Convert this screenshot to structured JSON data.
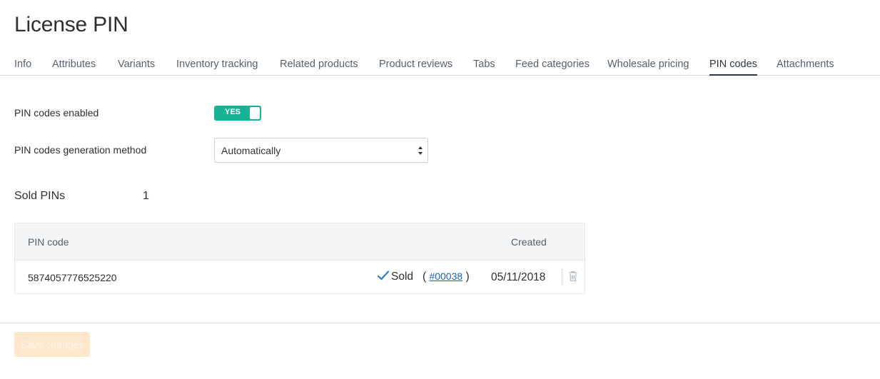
{
  "page": {
    "title": "License PIN"
  },
  "tabs": [
    {
      "label": "Info",
      "active": false
    },
    {
      "label": "Attributes",
      "active": false
    },
    {
      "label": "Variants",
      "active": false
    },
    {
      "label": "Inventory tracking",
      "active": false
    },
    {
      "label": "Related products",
      "active": false
    },
    {
      "label": "Product reviews",
      "active": false
    },
    {
      "label": "Tabs",
      "active": false
    },
    {
      "label": "Feed categories",
      "active": false
    },
    {
      "label": "Wholesale pricing",
      "active": false
    },
    {
      "label": "PIN codes",
      "active": true
    },
    {
      "label": "Attachments",
      "active": false
    }
  ],
  "form": {
    "pin_enabled_label": "PIN codes enabled",
    "pin_enabled_toggle": "YES",
    "generation_method_label": "PIN codes generation method",
    "generation_method_value": "Automatically"
  },
  "sold": {
    "label": "Sold PINs",
    "count": "1"
  },
  "table": {
    "headers": {
      "pin": "PIN code",
      "created": "Created"
    },
    "rows": [
      {
        "pin": "5874057776525220",
        "status": "Sold",
        "open_paren": "(",
        "order": "#00038",
        "close_paren": ")",
        "created": "05/11/2018"
      }
    ]
  },
  "footer": {
    "save_label": "Save changes"
  },
  "colors": {
    "accent": "#17b394",
    "link": "#1f5fa8",
    "save_bg": "#fde8cc",
    "check": "#3b82c4"
  },
  "icons": {
    "status": "checkmark-icon",
    "delete": "trash-icon",
    "select": "select-arrows-icon"
  }
}
